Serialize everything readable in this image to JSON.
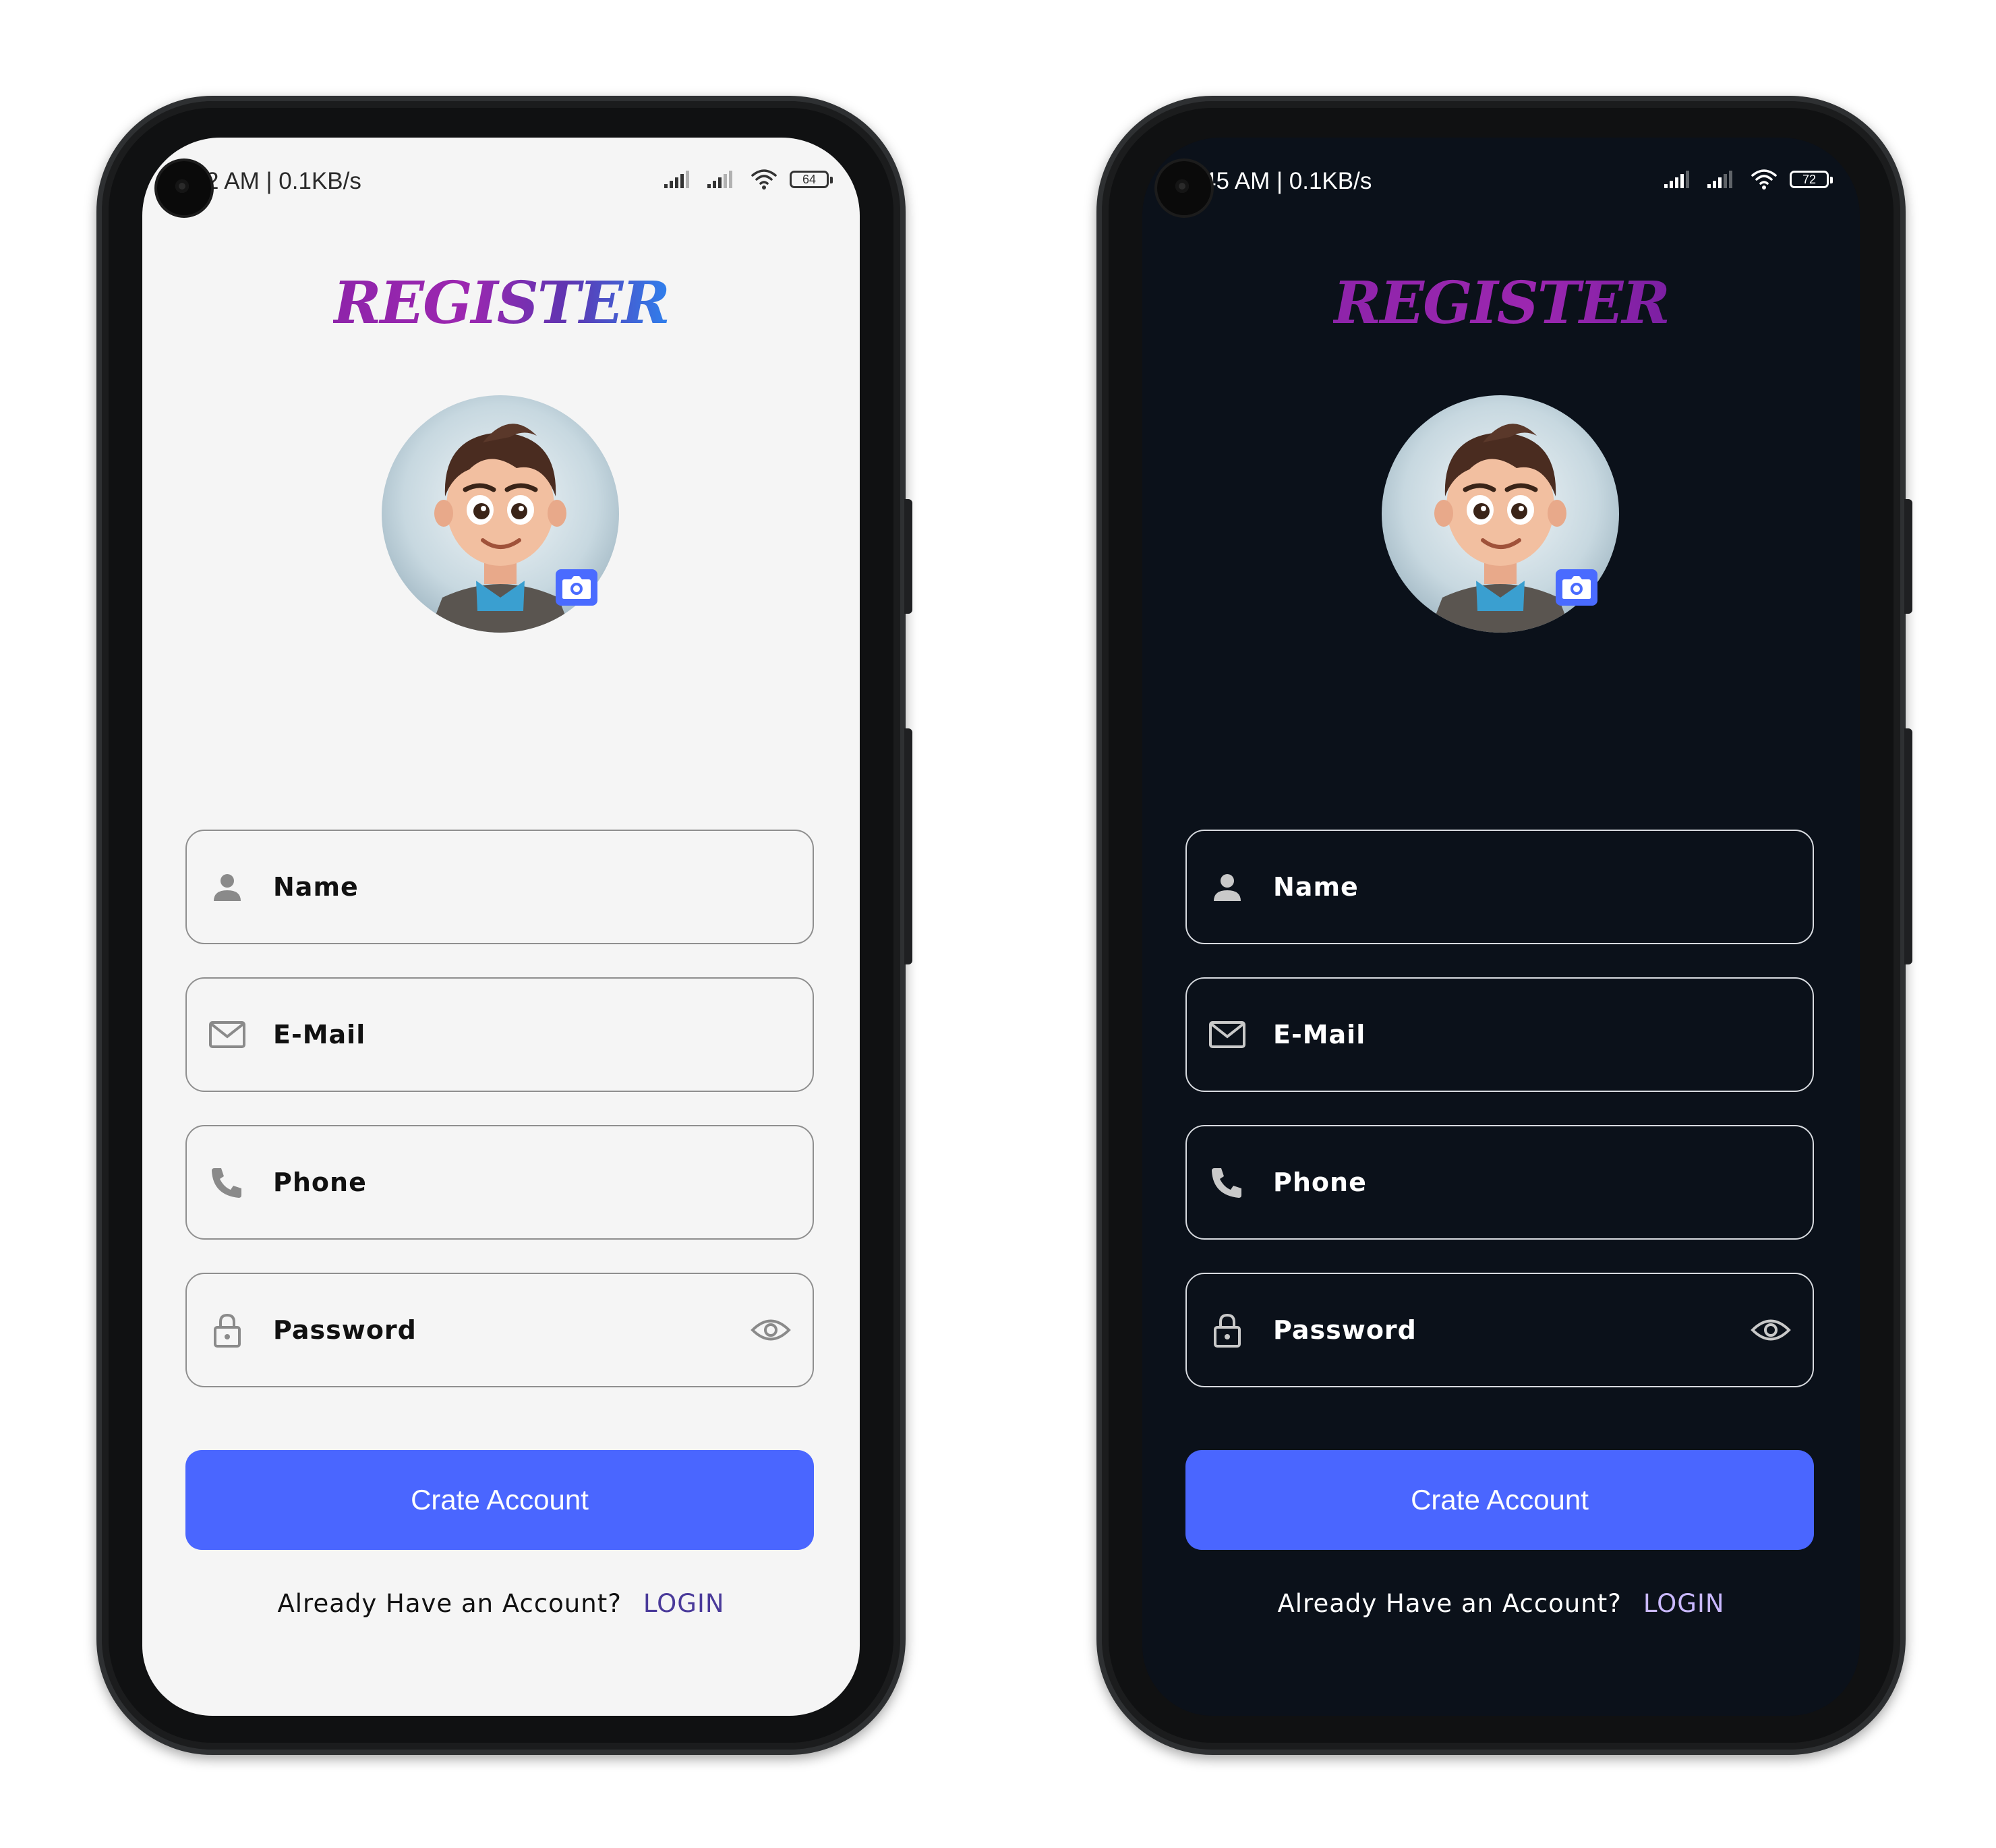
{
  "screens": [
    {
      "theme": "light",
      "status_bar": {
        "time_speed": "2 AM | 0.1KB/s",
        "battery": "64"
      },
      "title": "REGISTER",
      "fields": {
        "name": "Name",
        "email": "E-Mail",
        "phone": "Phone",
        "password": "Password"
      },
      "button": "Crate Account",
      "footer": {
        "question": "Already Have an Account?",
        "link": "LOGIN"
      }
    },
    {
      "theme": "dark",
      "status_bar": {
        "time_speed": "45 AM | 0.1KB/s",
        "battery": "72"
      },
      "title": "REGISTER",
      "fields": {
        "name": "Name",
        "email": "E-Mail",
        "phone": "Phone",
        "password": "Password"
      },
      "button": "Crate Account",
      "footer": {
        "question": "Already Have an Account?",
        "link": "LOGIN"
      }
    }
  ],
  "colors": {
    "accent": "#4a66ff",
    "light_bg": "#f5f5f5",
    "dark_bg": "#0b111a",
    "title_gradient": [
      "#9c27b0",
      "#2f80ed"
    ]
  },
  "icons": [
    "person-icon",
    "mail-icon",
    "phone-icon",
    "lock-icon",
    "eye-icon",
    "camera-icon",
    "signal-icon",
    "wifi-icon",
    "battery-icon"
  ]
}
